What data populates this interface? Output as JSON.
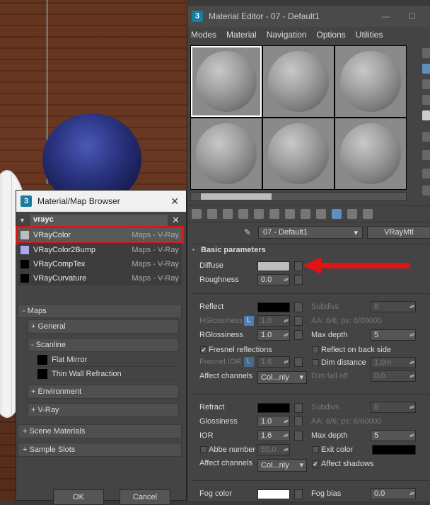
{
  "material_editor": {
    "title": "Material Editor - 07 - Default1",
    "app_icon": "3",
    "minimize": "—",
    "maximize": "☐",
    "menu": [
      "Modes",
      "Material",
      "Navigation",
      "Options",
      "Utilities"
    ],
    "material_name": "07 - Default1",
    "material_type": "VRayMtl",
    "rollout_title": "Basic parameters",
    "diffuse": {
      "label": "Diffuse",
      "color": "#bdbdbd"
    },
    "roughness": {
      "label": "Roughness",
      "value": "0.0"
    },
    "reflect": {
      "label": "Reflect",
      "color": "#000000",
      "subdivs_label": "Subdivs",
      "subdivs": "8",
      "hglossiness_label": "HGlossiness",
      "hglossiness": "1.0",
      "l": "L",
      "aa": "AA: 6/6; px: 6/60000",
      "rglossiness_label": "RGlossiness",
      "rglossiness": "1.0",
      "max_depth_label": "Max depth",
      "max_depth": "5",
      "fresnel": "Fresnel reflections",
      "reflect_back": "Reflect on back side",
      "fresnel_ior_label": "Fresnel IOR",
      "fresnel_ior": "1.6",
      "dim_distance_label": "Dim distance",
      "dim_distance": "1.0m",
      "affect_channels_label": "Affect channels",
      "affect_channels": "Col...nly",
      "dim_falloff_label": "Dim fall off",
      "dim_falloff": "0.0"
    },
    "refract": {
      "label": "Refract",
      "color": "#000000",
      "subdivs_label": "Subdivs",
      "subdivs": "8",
      "glossiness_label": "Glossiness",
      "glossiness": "1.0",
      "aa": "AA: 6/6; px: 6/60000",
      "ior_label": "IOR",
      "ior": "1.6",
      "max_depth_label": "Max depth",
      "max_depth": "5",
      "abbe_label": "Abbe number",
      "abbe": "50.0",
      "exit_color_label": "Exit color",
      "exit_color": "#000000",
      "affect_channels_label": "Affect channels",
      "affect_channels": "Col...nly",
      "affect_shadows": "Affect shadows"
    },
    "fog": {
      "label": "Fog color",
      "color": "#ffffff",
      "bias_label": "Fog bias",
      "bias": "0.0"
    }
  },
  "browser": {
    "title": "Material/Map Browser",
    "app_icon": "3",
    "close": "✕",
    "search_value": "vrayc",
    "clear": "✕",
    "results": [
      {
        "name": "VRayColor",
        "type": "Maps - V-Ray",
        "swatch": "#bdbdbd"
      },
      {
        "name": "VRayColor2Bump",
        "type": "Maps - V-Ray",
        "swatch": "#aaa9f0"
      },
      {
        "name": "VRayCompTex",
        "type": "Maps - V-Ray",
        "swatch": "#000000"
      },
      {
        "name": "VRayCurvature",
        "type": "Maps - V-Ray",
        "swatch": "#000000"
      }
    ],
    "maps_label": "- Maps",
    "general_label": "+ General",
    "scanline_label": "- Scanline",
    "flat_mirror": "Flat Mirror",
    "thin_wall": "Thin Wall Refraction",
    "environment_label": "+ Environment",
    "vray_label": "+ V-Ray",
    "scene_materials": "+ Scene Materials",
    "sample_slots": "+ Sample Slots",
    "ok": "OK",
    "cancel": "Cancel"
  },
  "colors": {
    "highlight": "#e01414",
    "arrow": "#e01414"
  }
}
